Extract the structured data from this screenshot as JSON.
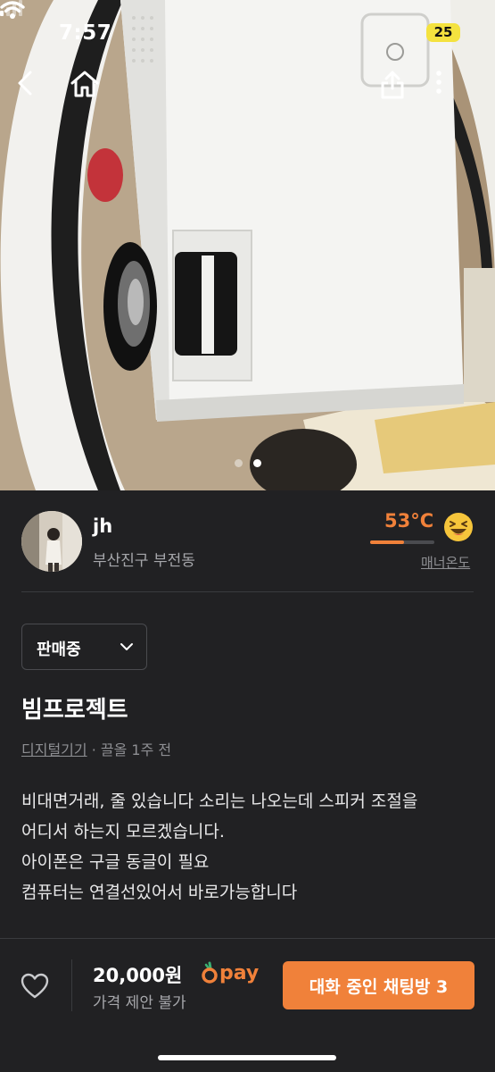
{
  "status_bar": {
    "time": "7:57",
    "battery": "25"
  },
  "nav": {
    "back_icon": "chevron-left-icon",
    "home_icon": "home-icon",
    "share_icon": "share-icon",
    "more_icon": "more-vertical-icon"
  },
  "gallery": {
    "total": 2,
    "current": 2
  },
  "seller": {
    "name": "jh",
    "location": "부산진구 부전동",
    "temperature": "53°C",
    "temperature_value": 53,
    "manner_label": "매너온도",
    "temperature_color": "#f0813a"
  },
  "listing": {
    "status": "판매중",
    "title": "빔프로젝트",
    "category": "디지털기기",
    "separator": " · ",
    "bumped": "끌올 1주 전",
    "description": [
      "비대면거래, 줄 있습니다 소리는 나오는데 스피커 조절을",
      "어디서 하는지 모르겠습니다.",
      "아이폰은 구글 동글이 필요",
      "컴퓨터는 연결선있어서 바로가능합니다"
    ]
  },
  "bottom_bar": {
    "price": "20,000원",
    "pay_label": "pay",
    "price_note": "가격 제안 불가",
    "chat_button": "대화 중인 채팅방 3"
  },
  "colors": {
    "accent": "#f0813a",
    "background": "#212123"
  }
}
